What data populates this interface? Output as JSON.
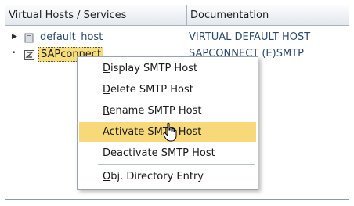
{
  "table": {
    "columns": [
      "Virtual Hosts / Services",
      "Documentation"
    ],
    "rows": [
      {
        "expander": "▶",
        "icon": "folder-icon",
        "label": "default_host",
        "doc": "VIRTUAL DEFAULT HOST"
      },
      {
        "expander": "•",
        "icon": "service-icon",
        "label": "SAPconnect",
        "doc": "SAPCONNECT (E)SMTP"
      }
    ]
  },
  "context_menu": {
    "items": [
      {
        "key": "D",
        "rest": "isplay SMTP Host"
      },
      {
        "key": "D",
        "rest": "elete SMTP Host"
      },
      {
        "key": "R",
        "rest": "ename SMTP Host"
      },
      {
        "key": "A",
        "rest": "ctivate SMTP Host"
      },
      {
        "key": "D",
        "rest": "eactivate SMTP Host"
      },
      {
        "key": "O",
        "rest": "bj. Directory Entry"
      }
    ]
  },
  "colors": {
    "highlight": "#f7d97a",
    "header_bg": "#e3e8ee",
    "link_text": "#2b4a6b"
  }
}
